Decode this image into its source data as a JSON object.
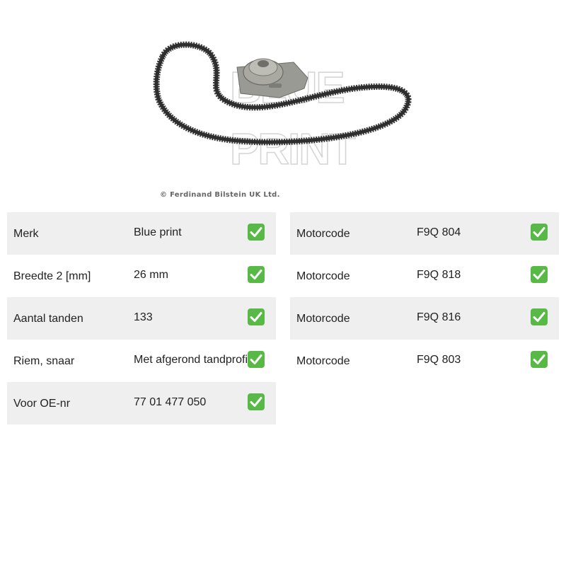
{
  "image": {
    "watermark": "BLUE PRINT",
    "copyright": "© Ferdinand Bilstein UK Ltd."
  },
  "left_specs": [
    {
      "label": "Merk",
      "value": "Blue print"
    },
    {
      "label": "Breedte 2 [mm]",
      "value": "26 mm"
    },
    {
      "label": "Aantal tanden",
      "value": "133"
    },
    {
      "label": "Riem, snaar",
      "value": "Met afgerond tandprofiel"
    },
    {
      "label": "Voor OE-nr",
      "value": "77 01 477 050"
    }
  ],
  "right_specs": [
    {
      "label": "Motorcode",
      "value": "F9Q 804"
    },
    {
      "label": "Motorcode",
      "value": "F9Q 818"
    },
    {
      "label": "Motorcode",
      "value": "F9Q 816"
    },
    {
      "label": "Motorcode",
      "value": "F9Q 803"
    }
  ],
  "colors": {
    "row_shade": "#efefef",
    "check_green": "#58b947"
  },
  "icons": {
    "check": "check-mark-icon"
  }
}
